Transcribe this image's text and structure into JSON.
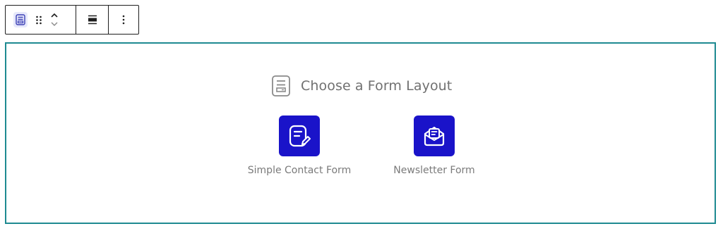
{
  "toolbar": {
    "block_type_icon": "form-block-icon",
    "drag_icon": "drag-handle-icon",
    "move_up_icon": "chevron-up-icon",
    "move_down_icon": "chevron-down-icon",
    "align_icon": "align-center-icon",
    "more_icon": "more-options-icon"
  },
  "placeholder": {
    "heading_icon": "form-layout-icon",
    "heading": "Choose a Form Layout",
    "options": [
      {
        "label": "Simple Contact Form",
        "icon": "contact-form-icon"
      },
      {
        "label": "Newsletter Form",
        "icon": "newsletter-icon"
      }
    ]
  },
  "colors": {
    "accent": "#1a13c9",
    "block_border": "#1e8a91",
    "toolbar_border": "#1e1e1e",
    "muted_text": "#707070"
  }
}
